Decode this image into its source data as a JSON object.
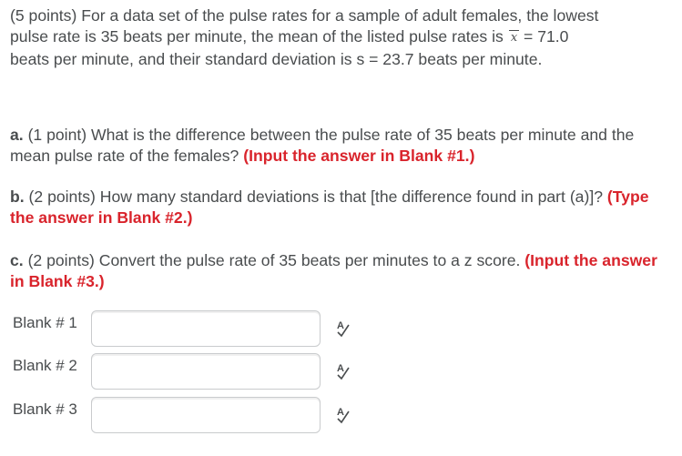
{
  "question": {
    "intro_line1": "(5 points) For a data set of the pulse rates for a sample of adult females, the lowest",
    "intro_line2a": "pulse rate is 35 beats per minute, the mean of the listed pulse rates is",
    "xbar_symbol": "x",
    "intro_line2b": "= 71.0",
    "intro_line3": "beats per minute, and their standard deviation is s = 23.7 beats per minute.",
    "part_a": {
      "label": "a.",
      "text": "(1 point) What is the difference between the pulse rate of 35 beats per minute and the mean pulse rate of the females?",
      "instruction": "(Input the answer in Blank #1.)"
    },
    "part_b": {
      "label": "b.",
      "text": "(2 points) How many standard deviations is that [the difference found in part (a)]?",
      "instruction": "(Type the answer in Blank #2.)"
    },
    "part_c": {
      "label": "c.",
      "text": "(2 points) Convert the pulse rate of 35 beats per minutes to a z score.",
      "instruction": "(Input the answer in Blank #3.)"
    }
  },
  "blanks": [
    {
      "label": "Blank # 1",
      "value": ""
    },
    {
      "label": "Blank # 2",
      "value": ""
    },
    {
      "label": "Blank # 3",
      "value": ""
    }
  ],
  "icons": {
    "spellcheck": "spellcheck-icon"
  },
  "colors": {
    "text": "#494c4e",
    "accent_red": "#d9242c",
    "input_border": "#c9cbcd"
  }
}
